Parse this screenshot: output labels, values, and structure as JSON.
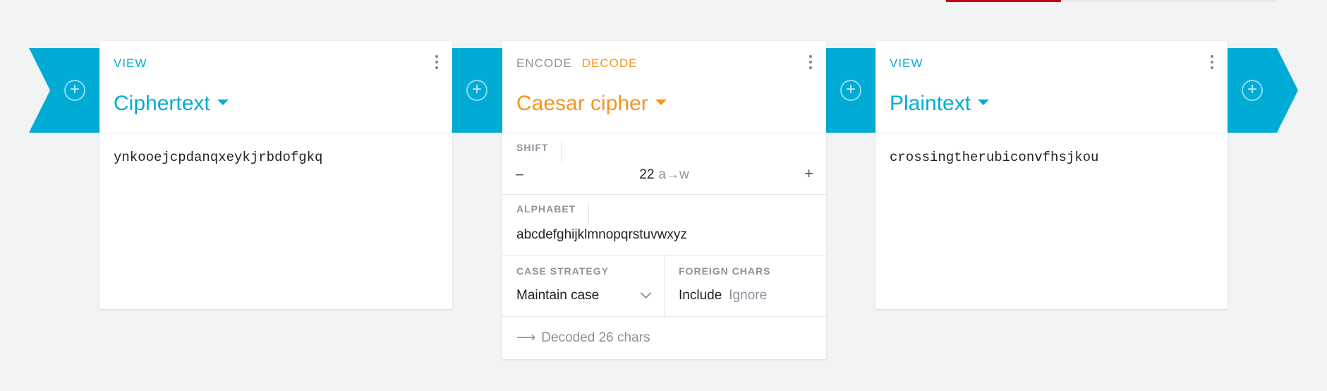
{
  "pipeline": {
    "cards": [
      {
        "mode_label": "VIEW",
        "title": "Ciphertext",
        "content": "ynkooejcpdanqxeykjrbdofgkq"
      },
      {
        "mode_encode": "ENCODE",
        "mode_decode": "DECODE",
        "title": "Caesar cipher",
        "shift": {
          "label": "SHIFT",
          "minus": "−",
          "value": "22",
          "mapping": "a→w",
          "plus": "+"
        },
        "alphabet": {
          "label": "ALPHABET",
          "value": "abcdefghijklmnopqrstuvwxyz"
        },
        "case_strategy": {
          "label": "CASE STRATEGY",
          "value": "Maintain case"
        },
        "foreign_chars": {
          "label": "FOREIGN CHARS",
          "option_on": "Include",
          "option_off": "Ignore"
        },
        "status": "Decoded 26 chars"
      },
      {
        "mode_label": "VIEW",
        "title": "Plaintext",
        "content": "crossingtherubiconvfhsjkou"
      }
    ],
    "add_icon": "plus-circle-icon",
    "menu_icon": "more-vertical-icon",
    "status_icon": "arrow-right-icon",
    "colors": {
      "accent": "#00acd5",
      "decode": "#f7941d",
      "muted": "#8c939d"
    }
  }
}
